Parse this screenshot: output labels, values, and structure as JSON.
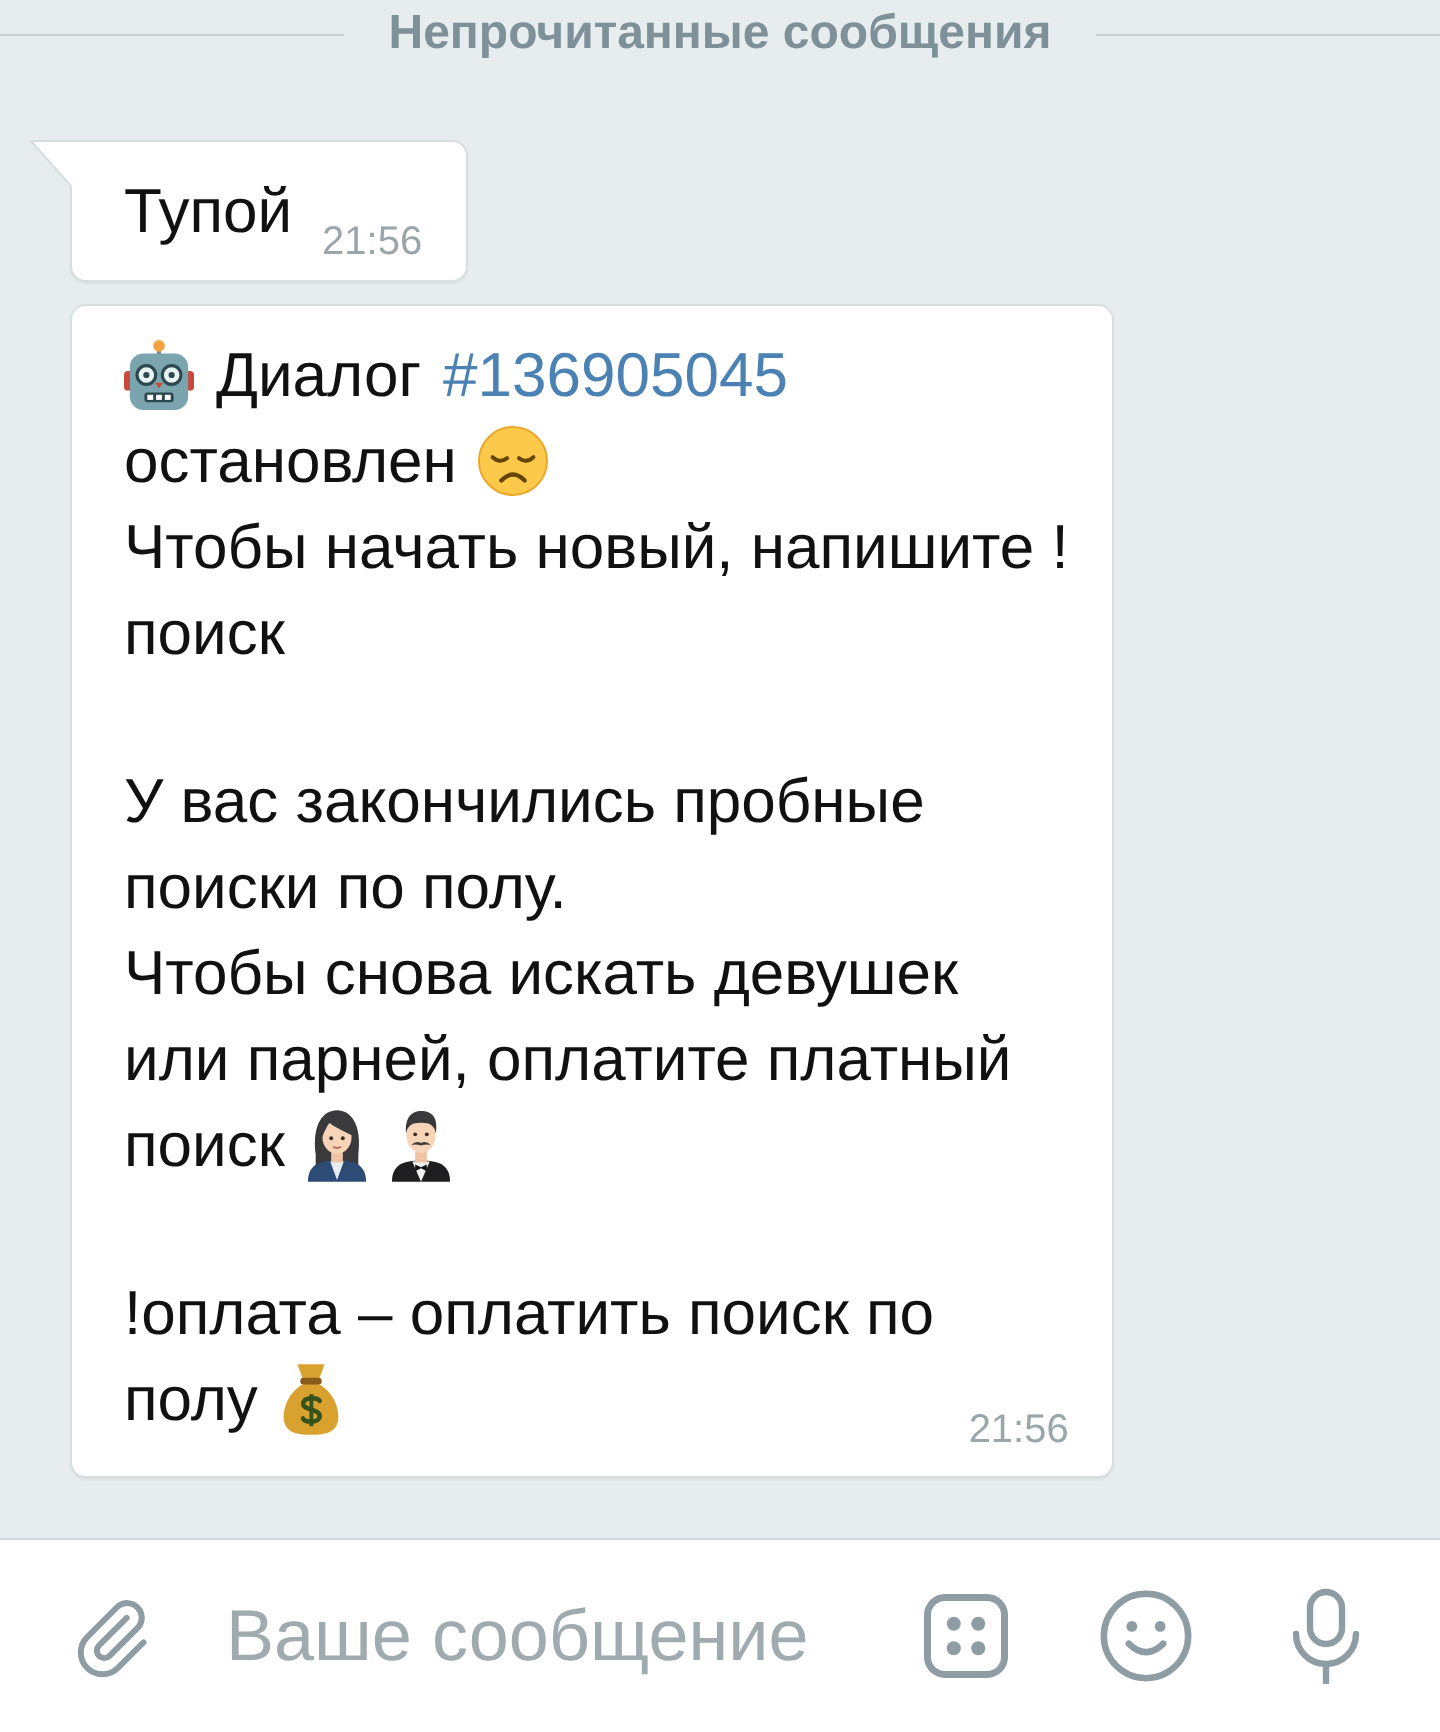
{
  "unread_divider": {
    "label": "Непрочитанные сообщения"
  },
  "messages": [
    {
      "tail": true,
      "paragraphs": [
        {
          "lines": [
            {
              "segments": [
                {
                  "kind": "text",
                  "text": "Тупой"
                }
              ]
            }
          ]
        }
      ],
      "time": "21:56"
    },
    {
      "tail": false,
      "paragraphs": [
        {
          "lines": [
            {
              "segments": [
                {
                  "kind": "robot"
                },
                {
                  "kind": "text",
                  "text": "Диалог"
                },
                {
                  "kind": "hashtag",
                  "text": "#136905045"
                }
              ]
            },
            {
              "segments": [
                {
                  "kind": "text",
                  "text": "остановлен"
                },
                {
                  "kind": "sad"
                }
              ]
            },
            {
              "segments": [
                {
                  "kind": "text",
                  "text": "Чтобы начать новый, напишите !"
                }
              ]
            },
            {
              "segments": [
                {
                  "kind": "text",
                  "text": "поиск"
                }
              ]
            }
          ]
        },
        {
          "lines": [
            {
              "segments": [
                {
                  "kind": "text",
                  "text": "У вас закончились пробные"
                }
              ]
            },
            {
              "segments": [
                {
                  "kind": "text",
                  "text": "поиски по полу."
                }
              ]
            },
            {
              "segments": [
                {
                  "kind": "text",
                  "text": "Чтобы снова искать девушек"
                }
              ]
            },
            {
              "segments": [
                {
                  "kind": "text",
                  "text": "или парней, оплатите платный"
                }
              ]
            },
            {
              "segments": [
                {
                  "kind": "text",
                  "text": "поиск"
                },
                {
                  "kind": "woman"
                },
                {
                  "kind": "man"
                }
              ]
            }
          ]
        },
        {
          "lines": [
            {
              "segments": [
                {
                  "kind": "text",
                  "text": "!оплата – оплатить поиск по"
                }
              ]
            },
            {
              "segments": [
                {
                  "kind": "text",
                  "text": "полу"
                },
                {
                  "kind": "moneybag"
                }
              ]
            }
          ]
        }
      ],
      "time": "21:56"
    }
  ],
  "composer": {
    "placeholder": "Ваше сообщение"
  }
}
